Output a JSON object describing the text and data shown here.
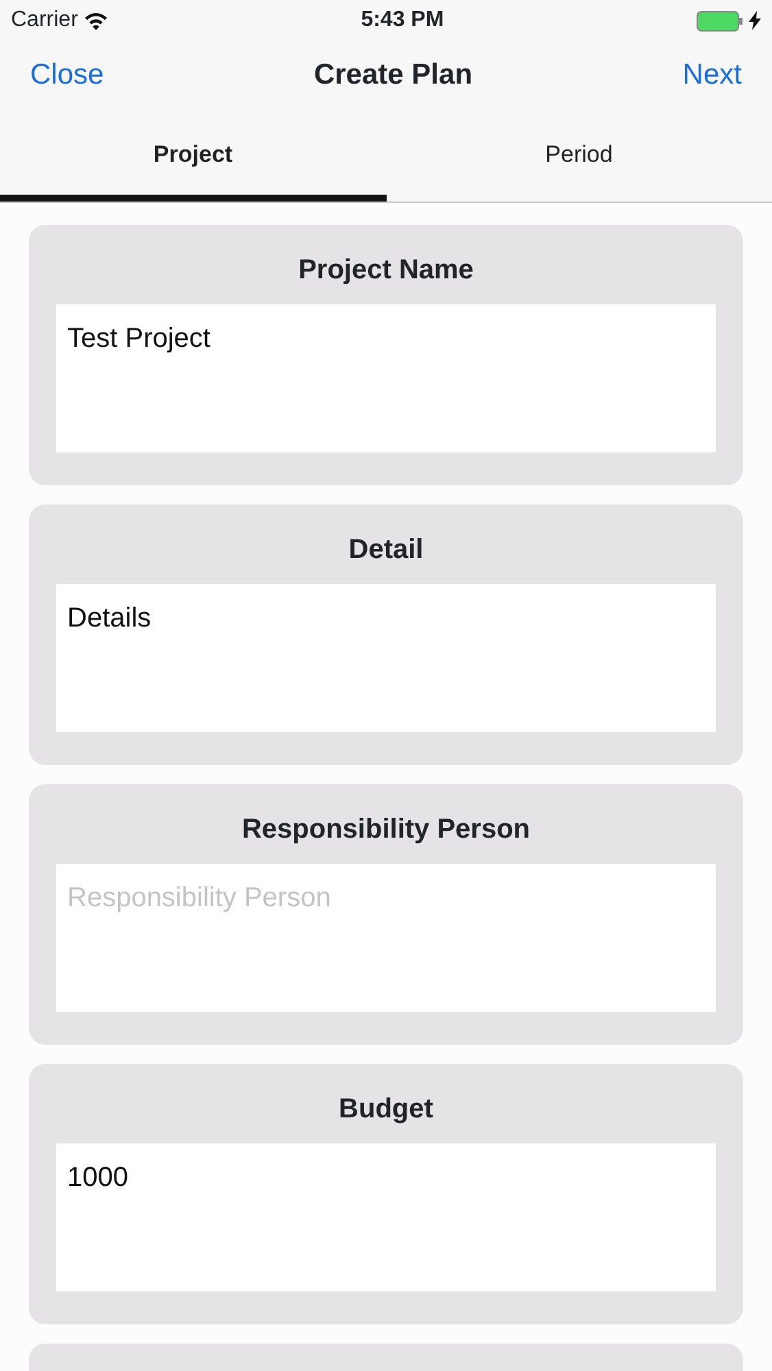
{
  "status_bar": {
    "carrier": "Carrier",
    "time": "5:43 PM",
    "charging": true
  },
  "nav": {
    "left": "Close",
    "title": "Create Plan",
    "right": "Next"
  },
  "tabs": [
    {
      "label": "Project",
      "selected": true
    },
    {
      "label": "Period",
      "selected": false
    }
  ],
  "fields": [
    {
      "label": "Project Name",
      "value": "Test Project"
    },
    {
      "label": "Detail",
      "value": "Details"
    },
    {
      "label": "Responsibility Person",
      "placeholder": "Responsibility Person"
    },
    {
      "label": "Budget",
      "value": "1000"
    }
  ]
}
